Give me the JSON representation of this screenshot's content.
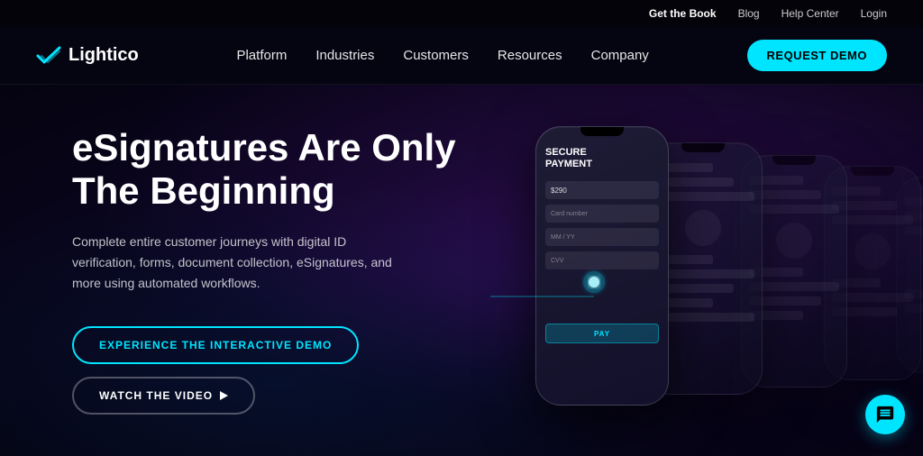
{
  "utility_bar": {
    "get_the_book": "Get the Book",
    "blog": "Blog",
    "help_center": "Help Center",
    "login": "Login"
  },
  "navbar": {
    "logo_text": "Lightico",
    "nav_items": [
      {
        "label": "Platform",
        "id": "platform"
      },
      {
        "label": "Industries",
        "id": "industries"
      },
      {
        "label": "Customers",
        "id": "customers"
      },
      {
        "label": "Resources",
        "id": "resources"
      },
      {
        "label": "Company",
        "id": "company"
      }
    ],
    "cta_label": "REQUEST DEMO"
  },
  "hero": {
    "title_line1": "eSignatures Are Only",
    "title_line2": "The Beginning",
    "description": "Complete entire customer journeys with digital ID verification, forms, document collection, eSignatures, and more using automated workflows.",
    "btn_demo": "EXPERIENCE THE INTERACTIVE DEMO",
    "btn_video": "WATCH THE VIDEO",
    "phone_screen_title": "SECURE\nPAYMENT",
    "phone_field_amount": "$290",
    "phone_field_card": "Card number",
    "phone_field_expiry": "MM / YY",
    "phone_field_cvv": "CVV",
    "phone_pay_label": "PAY"
  },
  "chat": {
    "icon_label": "chat-icon"
  }
}
